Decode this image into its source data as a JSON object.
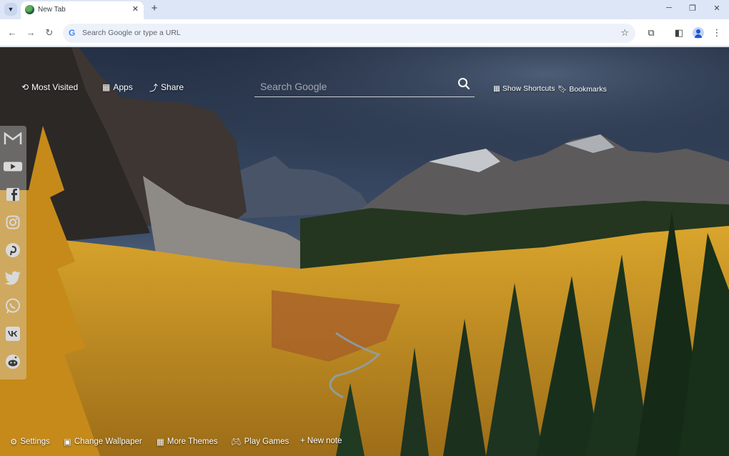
{
  "browser": {
    "tab_title": "New Tab",
    "address_placeholder": "Search Google or type a URL"
  },
  "newtab": {
    "top_links": [
      {
        "label": "Most Visited",
        "icon": "history-icon"
      },
      {
        "label": "Apps",
        "icon": "apps-grid-icon"
      },
      {
        "label": "Share",
        "icon": "share-icon"
      }
    ],
    "search_placeholder": "Search Google",
    "right_links": [
      {
        "label": "Show Shortcuts",
        "icon": "grid-icon"
      },
      {
        "label": "Bookmarks",
        "icon": "bookmark-icon"
      }
    ],
    "social_links": [
      "gmail-icon",
      "youtube-icon",
      "facebook-icon",
      "instagram-icon",
      "pinterest-icon",
      "twitter-icon",
      "whatsapp-icon",
      "vk-icon",
      "reddit-icon"
    ],
    "bottom_links": [
      {
        "label": "Settings",
        "icon": "gear-icon"
      },
      {
        "label": "Change Wallpaper",
        "icon": "wallpaper-icon"
      },
      {
        "label": "More Themes",
        "icon": "themes-grid-icon"
      },
      {
        "label": "Play Games",
        "icon": "gamepad-icon"
      },
      {
        "label": "+ New note",
        "icon": "plus-icon"
      }
    ]
  },
  "colors": {
    "sky_dark": "#283548",
    "mountain": "#4b4f58",
    "forest_gold": "#c9941d",
    "spruce": "#1f3b22"
  }
}
